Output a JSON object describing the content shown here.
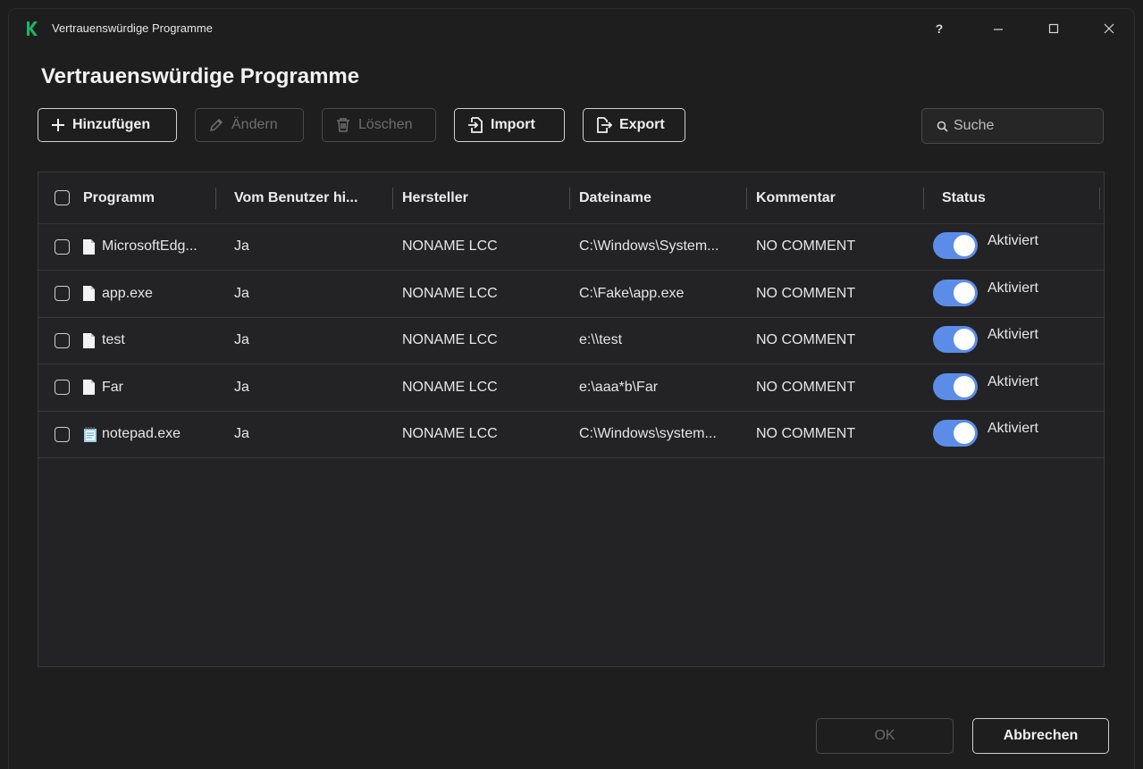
{
  "window": {
    "title": "Vertrauenswürdige Programme",
    "help_label": "?",
    "minimize_label": "—",
    "maximize_label": "☐",
    "close_label": "✕"
  },
  "page": {
    "title": "Vertrauenswürdige Programme"
  },
  "toolbar": {
    "add_label": "Hinzufügen",
    "edit_label": "Ändern",
    "delete_label": "Löschen",
    "import_label": "Import",
    "export_label": "Export",
    "search_placeholder": "Suche"
  },
  "table": {
    "columns": [
      "Programm",
      "Vom Benutzer hi...",
      "Hersteller",
      "Dateiname",
      "Kommentar",
      "Status"
    ],
    "rows": [
      {
        "program": "MicrosoftEdg...",
        "by_user": "Ja",
        "vendor": "NONAME LCC",
        "file": "C:\\Windows\\System...",
        "comment": "NO COMMENT",
        "status": "Aktiviert",
        "icon": "file-icon",
        "enabled": true
      },
      {
        "program": "app.exe",
        "by_user": "Ja",
        "vendor": "NONAME LCC",
        "file": "C:\\Fake\\app.exe",
        "comment": "NO COMMENT",
        "status": "Aktiviert",
        "icon": "file-icon",
        "enabled": true
      },
      {
        "program": "test",
        "by_user": "Ja",
        "vendor": "NONAME LCC",
        "file": "e:\\\\test",
        "comment": "NO COMMENT",
        "status": "Aktiviert",
        "icon": "file-icon",
        "enabled": true
      },
      {
        "program": "Far",
        "by_user": "Ja",
        "vendor": "NONAME LCC",
        "file": "e:\\aaa*b\\Far",
        "comment": "NO COMMENT",
        "status": "Aktiviert",
        "icon": "file-icon",
        "enabled": true
      },
      {
        "program": "notepad.exe",
        "by_user": "Ja",
        "vendor": "NONAME LCC",
        "file": "C:\\Windows\\system...",
        "comment": "NO COMMENT",
        "status": "Aktiviert",
        "icon": "notepad-icon",
        "enabled": true
      }
    ]
  },
  "footer": {
    "ok_label": "OK",
    "cancel_label": "Abbrechen"
  },
  "colors": {
    "accent": "#5b8de8",
    "background": "#1e1e1e",
    "table_bg": "#232326"
  }
}
